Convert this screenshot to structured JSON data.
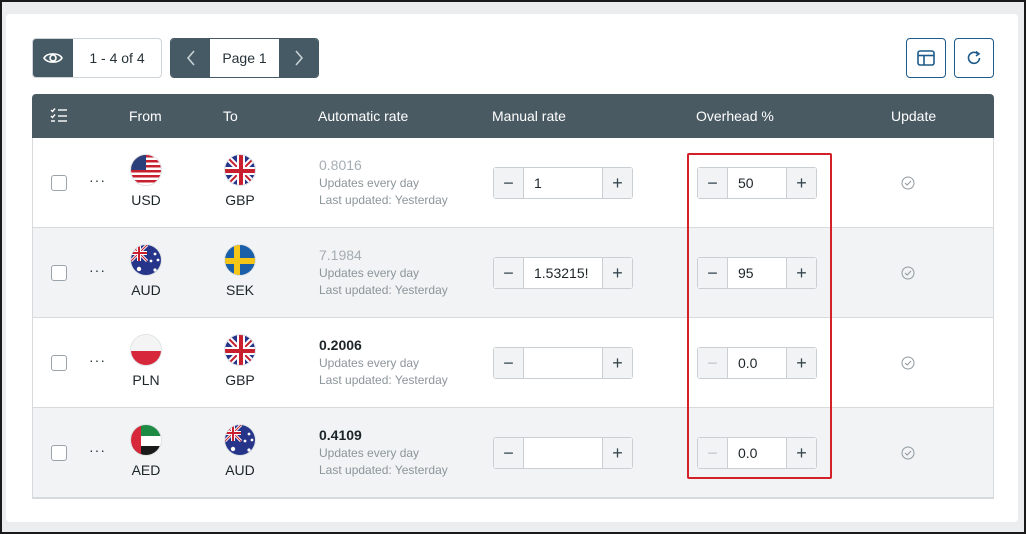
{
  "toolbar": {
    "visibility_icon": "eye-icon",
    "range_text": "1 - 4 of 4",
    "prev_icon": "chevron-left-icon",
    "page_label": "Page 1",
    "next_icon": "chevron-right-icon",
    "layout_icon": "layout-icon",
    "refresh_icon": "refresh-icon"
  },
  "table": {
    "select_all_icon": "checklist-icon",
    "headers": {
      "from": "From",
      "to": "To",
      "automatic_rate": "Automatic rate",
      "manual_rate": "Manual rate",
      "overhead": "Overhead %",
      "update": "Update"
    },
    "rows": [
      {
        "from": "USD",
        "from_flag": "us-flag-icon",
        "to": "GBP",
        "to_flag": "uk-flag-icon",
        "auto_rate": "0.8016",
        "auto_rate_muted": true,
        "frequency": "Updates every day",
        "last_updated": "Last updated: Yesterday",
        "manual_rate": "1",
        "overhead": "50",
        "overhead_minus_enabled": true
      },
      {
        "from": "AUD",
        "from_flag": "au-flag-icon",
        "to": "SEK",
        "to_flag": "se-flag-icon",
        "auto_rate": "7.1984",
        "auto_rate_muted": true,
        "frequency": "Updates every day",
        "last_updated": "Last updated: Yesterday",
        "manual_rate": "1.53215!",
        "overhead": "95",
        "overhead_minus_enabled": true
      },
      {
        "from": "PLN",
        "from_flag": "pl-flag-icon",
        "to": "GBP",
        "to_flag": "uk-flag-icon",
        "auto_rate": "0.2006",
        "auto_rate_muted": false,
        "frequency": "Updates every day",
        "last_updated": "Last updated: Yesterday",
        "manual_rate": "",
        "overhead": "0.0",
        "overhead_minus_enabled": false
      },
      {
        "from": "AED",
        "from_flag": "ae-flag-icon",
        "to": "AUD",
        "to_flag": "au-flag-icon",
        "auto_rate": "0.4109",
        "auto_rate_muted": false,
        "frequency": "Updates every day",
        "last_updated": "Last updated: Yesterday",
        "manual_rate": "",
        "overhead": "0.0",
        "overhead_minus_enabled": false
      }
    ],
    "stepper_minus": "−",
    "stepper_plus": "+",
    "row_menu": "···",
    "update_icon": "check-circle-icon"
  },
  "colors": {
    "header_bg": "#4a5a63",
    "accent": "#1e5b8a",
    "highlight": "#d42027"
  }
}
